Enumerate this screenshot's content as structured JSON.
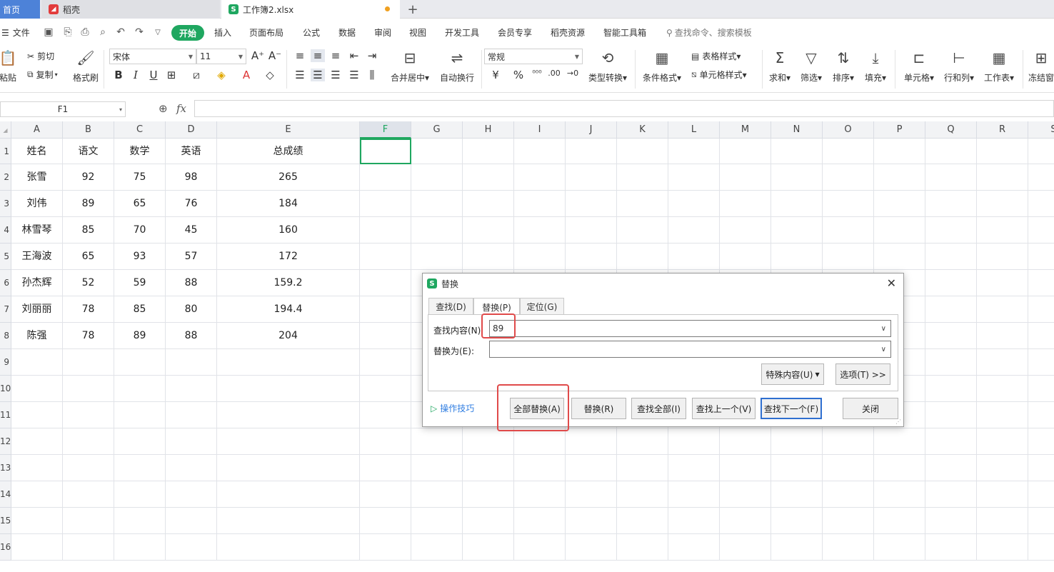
{
  "tabs": {
    "home": "首页",
    "daoke": "稻壳",
    "file": "工作簿2.xlsx",
    "plus": "+"
  },
  "menu": {
    "file": "文件",
    "items": [
      "开始",
      "插入",
      "页面布局",
      "公式",
      "数据",
      "审阅",
      "视图",
      "开发工具",
      "会员专享",
      "稻壳资源",
      "智能工具箱"
    ],
    "search": "查找命令、搜索模板"
  },
  "ribbon": {
    "paste": "粘贴",
    "cut": "剪切",
    "copy": "复制",
    "format_painter": "格式刷",
    "font": "宋体",
    "size": "11",
    "merge": "合并居中",
    "wrap": "自动换行",
    "number_format": "常规",
    "type_convert": "类型转换",
    "cond_format": "条件格式",
    "table_style": "表格样式",
    "cell_style": "单元格样式",
    "sum": "求和",
    "filter": "筛选",
    "sort": "排序",
    "fill": "填充",
    "cell": "单元格",
    "row_col": "行和列",
    "sheet": "工作表",
    "freeze": "冻结窗"
  },
  "formula_bar": {
    "name_box": "F1",
    "fx": "fx",
    "value": ""
  },
  "columns": [
    "A",
    "B",
    "C",
    "D",
    "E",
    "F",
    "G",
    "H",
    "I",
    "J",
    "K",
    "L",
    "M",
    "N",
    "O",
    "P",
    "Q",
    "R",
    "S"
  ],
  "rows": [
    "1",
    "2",
    "3",
    "4",
    "5",
    "6",
    "7",
    "8",
    "9",
    "10",
    "11",
    "12",
    "13",
    "14",
    "15",
    "16"
  ],
  "table": {
    "header": [
      "姓名",
      "语文",
      "数学",
      "英语",
      "总成绩"
    ],
    "data": [
      [
        "张雪",
        "92",
        "75",
        "98",
        "265"
      ],
      [
        "刘伟",
        "89",
        "65",
        "76",
        "184"
      ],
      [
        "林雪琴",
        "85",
        "70",
        "45",
        "160"
      ],
      [
        "王海波",
        "65",
        "93",
        "57",
        "172"
      ],
      [
        "孙杰辉",
        "52",
        "59",
        "88",
        "159.2"
      ],
      [
        "刘丽丽",
        "78",
        "85",
        "80",
        "194.4"
      ],
      [
        "陈强",
        "78",
        "89",
        "88",
        "204"
      ]
    ]
  },
  "dialog": {
    "title": "替换",
    "tabs": [
      "查找(D)",
      "替换(P)",
      "定位(G)"
    ],
    "find_label": "查找内容(N):",
    "find_value": "89",
    "replace_label": "替换为(E):",
    "replace_value": "",
    "special": "特殊内容(U)",
    "options": "选项(T) >>",
    "tips": "操作技巧",
    "buttons": {
      "replace_all": "全部替换(A)",
      "replace": "替换(R)",
      "find_all": "查找全部(I)",
      "find_prev": "查找上一个(V)",
      "find_next": "查找下一个(F)",
      "close": "关闭"
    }
  },
  "colors": {
    "accent_green": "#1fa760",
    "highlight_red": "#e04a4a",
    "tab_blue": "#4d82d8"
  }
}
